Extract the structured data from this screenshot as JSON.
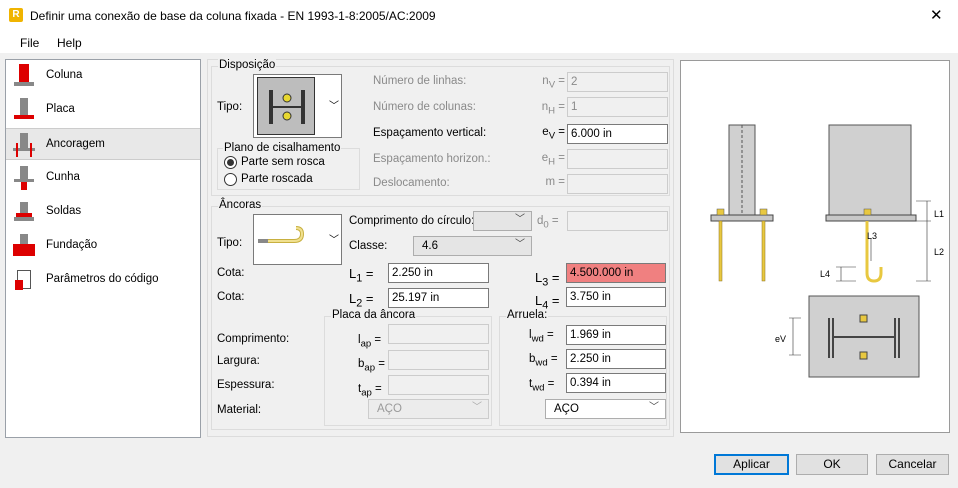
{
  "window": {
    "title": "Definir uma conexão de base da coluna fixada - EN 1993-1-8:2005/AC:2009",
    "close": "✕"
  },
  "menu": {
    "file": "File",
    "help": "Help"
  },
  "sidebar": {
    "items": [
      {
        "label": "Coluna"
      },
      {
        "label": "Placa"
      },
      {
        "label": "Ancoragem"
      },
      {
        "label": "Cunha"
      },
      {
        "label": "Soldas"
      },
      {
        "label": "Fundação"
      },
      {
        "label": "Parâmetros do código"
      }
    ]
  },
  "disposicao": {
    "title": "Disposição",
    "tipo_label": "Tipo:",
    "plano_title": "Plano de cisalhamento",
    "radio1": "Parte sem rosca",
    "radio2": "Parte roscada",
    "selected": "Parte sem rosca",
    "rows": [
      {
        "label": "Número de linhas:",
        "sym": "n",
        "sub": "V",
        "eq": "=",
        "value": "2"
      },
      {
        "label": "Número de colunas:",
        "sym": "n",
        "sub": "H",
        "eq": "=",
        "value": "1"
      },
      {
        "label": "Espaçamento vertical:",
        "sym": "e",
        "sub": "V",
        "eq": "=",
        "value": "6.000 in"
      },
      {
        "label": "Espaçamento horizon.:",
        "sym": "e",
        "sub": "H",
        "eq": "=",
        "value": ""
      },
      {
        "label": "Deslocamento:",
        "sym": "m",
        "sub": "",
        "eq": "=",
        "value": ""
      }
    ]
  },
  "ancoras": {
    "title": "Âncoras",
    "tipo_label": "Tipo:",
    "circ_label": "Comprimento do círculo:",
    "d0_sym": "d",
    "d0_sub": "0",
    "d0_value": "",
    "classe_label": "Classe:",
    "classe_value": "4.6",
    "cota1": "Cota:",
    "cota2": "Cota:",
    "L1_sym": "L",
    "L1_sub": "1",
    "L1": "2.250 in",
    "L2_sym": "L",
    "L2_sub": "2",
    "L2": "25.197 in",
    "L3_sym": "L",
    "L3_sub": "3",
    "L3": "4.500.000 in",
    "L4_sym": "L",
    "L4_sub": "4",
    "L4": "3.750 in",
    "eq": "=",
    "comprimento": "Comprimento:",
    "largura": "Largura:",
    "espessura": "Espessura:",
    "material": "Material:",
    "placa": {
      "title": "Placa da âncora",
      "l_sym": "l",
      "l_sub": "ap",
      "b_sym": "b",
      "b_sub": "ap",
      "t_sym": "t",
      "t_sub": "ap",
      "l": "",
      "b": "",
      "t": "",
      "material": "AÇO"
    },
    "arruela": {
      "title": "Arruela:",
      "l_sym": "l",
      "l_sub": "wd",
      "b_sym": "b",
      "b_sub": "wd",
      "t_sym": "t",
      "t_sub": "wd",
      "l": "1.969 in",
      "b": "2.250 in",
      "t": "0.394 in",
      "material": "AÇO"
    }
  },
  "preview": {
    "L1": "L1",
    "L2": "L2",
    "L3": "L3",
    "L4": "L4",
    "eV": "eV"
  },
  "buttons": {
    "apply": "Aplicar",
    "ok": "OK",
    "cancel": "Cancelar"
  },
  "colors": {
    "accent": "#0078d7",
    "error": "#f08080",
    "anchor": "#e8c840"
  }
}
